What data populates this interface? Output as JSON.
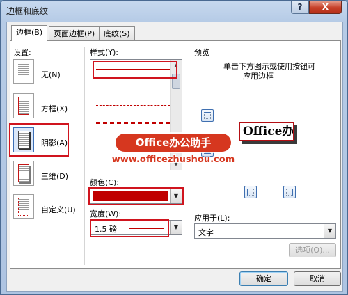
{
  "window": {
    "title": "边框和底纹",
    "help_label": "?",
    "close_label": "X"
  },
  "tabs": [
    {
      "label": "边框(B)",
      "active": true
    },
    {
      "label": "页面边框(P)",
      "active": false
    },
    {
      "label": "底纹(S)",
      "active": false
    }
  ],
  "settings": {
    "label": "设置:",
    "presets": [
      {
        "label": "无(N)"
      },
      {
        "label": "方框(X)"
      },
      {
        "label": "阴影(A)",
        "selected": true
      },
      {
        "label": "三维(D)"
      },
      {
        "label": "自定义(U)"
      }
    ]
  },
  "style": {
    "label": "样式(Y):"
  },
  "color": {
    "label": "颜色(C):",
    "value": "#c00000"
  },
  "width": {
    "label": "宽度(W):",
    "value": "1.5 磅"
  },
  "preview": {
    "label": "预览",
    "hint_line1": "单击下方图示或使用按钮可",
    "hint_line2": "应用边框",
    "sample_text": "Office办"
  },
  "apply_to": {
    "label": "应用于(L):",
    "value": "文字"
  },
  "buttons": {
    "options": "选项(O)...",
    "ok": "确定",
    "cancel": "取消"
  },
  "watermark": {
    "brand": "Office办公助手",
    "url": "www.officezhushou.com"
  },
  "colors": {
    "highlight_red": "#d0141e",
    "border_red": "#c00000"
  }
}
